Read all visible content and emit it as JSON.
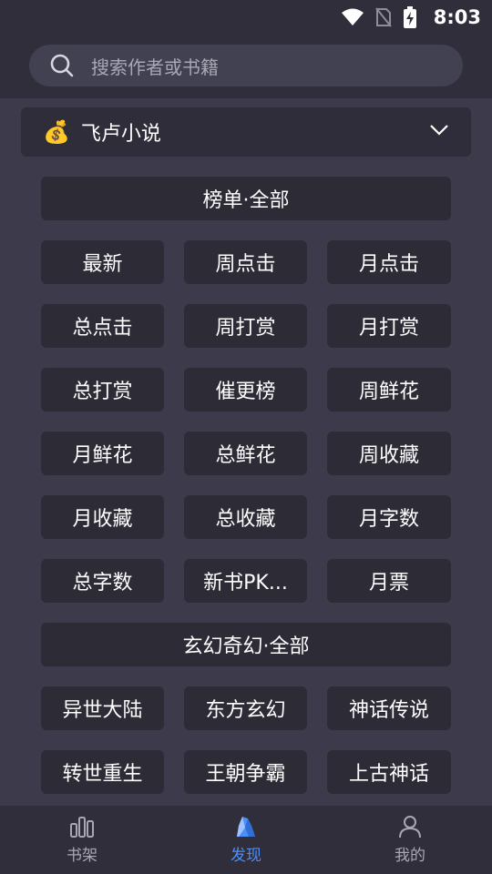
{
  "status_bar": {
    "time": "8:03"
  },
  "search": {
    "placeholder": "搜索作者或书籍"
  },
  "source": {
    "emoji": "💰",
    "label": "飞卢小说"
  },
  "sections": [
    {
      "title": "榜单·全部",
      "items": [
        "最新",
        "周点击",
        "月点击",
        "总点击",
        "周打赏",
        "月打赏",
        "总打赏",
        "催更榜",
        "周鲜花",
        "月鲜花",
        "总鲜花",
        "周收藏",
        "月收藏",
        "总收藏",
        "月字数",
        "总字数",
        "新书PK...",
        "月票"
      ]
    },
    {
      "title": "玄幻奇幻·全部",
      "items": [
        "异世大陆",
        "东方玄幻",
        "神话传说",
        "转世重生",
        "王朝争霸",
        "上古神话"
      ]
    }
  ],
  "bottom_nav": [
    {
      "label": "书架",
      "icon": "bar-chart-icon",
      "active": false
    },
    {
      "label": "发现",
      "icon": "crystal-icon",
      "active": true
    },
    {
      "label": "我的",
      "icon": "person-icon",
      "active": false
    }
  ],
  "colors": {
    "accent": "#4e8ef7",
    "background": "#3d3a4c",
    "button": "#2c2b36"
  }
}
